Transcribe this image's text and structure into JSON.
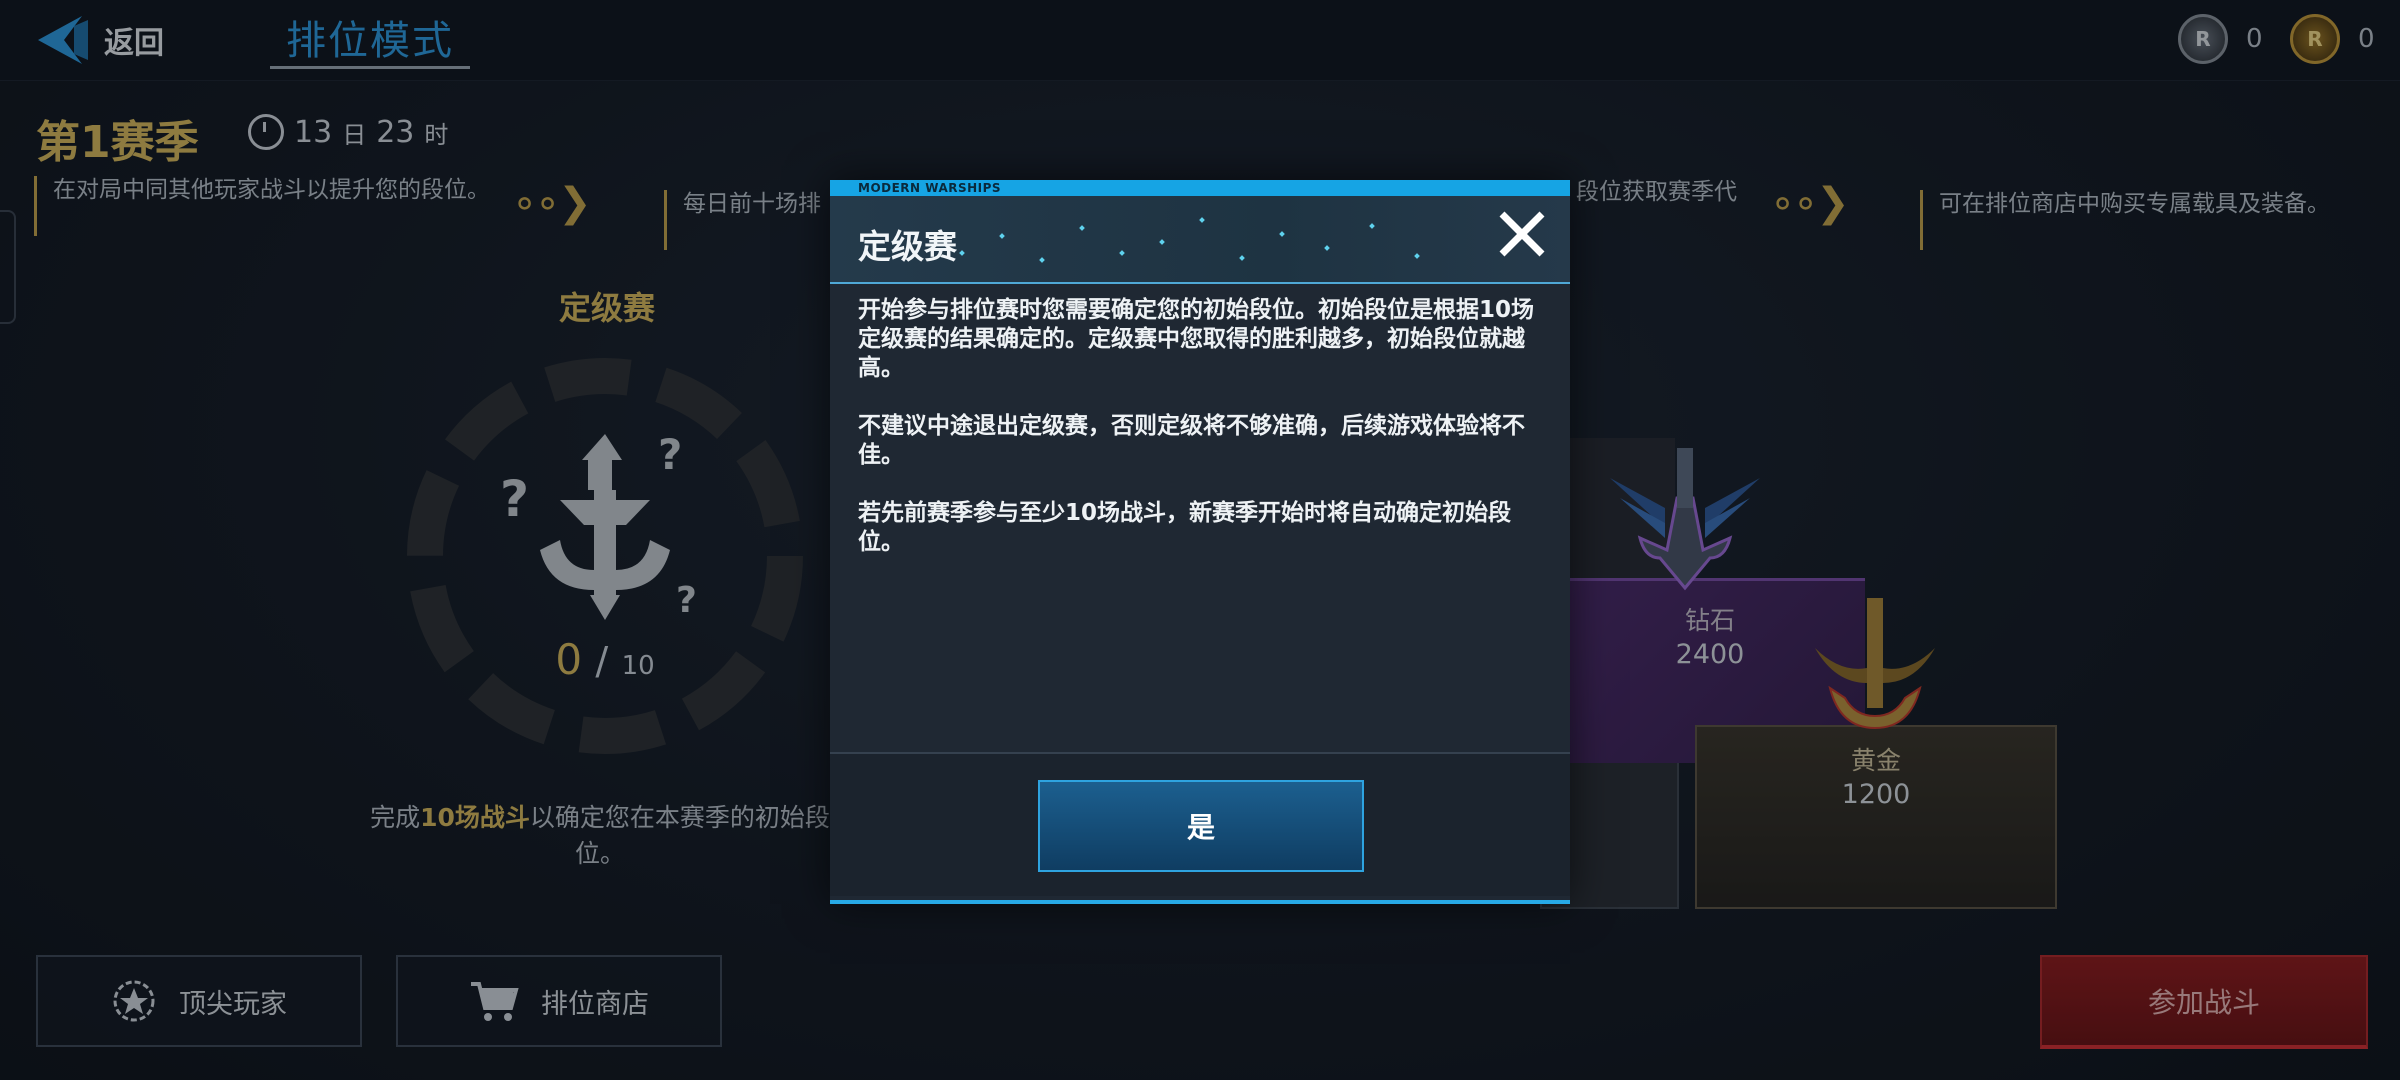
{
  "header": {
    "back_label": "返回",
    "mode_title": "排位模式",
    "mode_subtitle": "",
    "currencies": [
      {
        "icon": "silver-rank-coin-icon",
        "value": "0"
      },
      {
        "icon": "gold-rank-coin-icon",
        "value": "0"
      }
    ]
  },
  "season": {
    "title": "第1赛季",
    "timer_days": "13",
    "timer_days_unit": "日",
    "timer_hours": "23",
    "timer_hours_unit": "时"
  },
  "info_strip": [
    "在对局中同其他玩家战斗以提升您的段位。",
    "每日前十场排",
    "段位获取赛季代",
    "可在排位商店中购买专属载具及装备。"
  ],
  "qualifier": {
    "title": "定级赛",
    "done": "0",
    "separator": "/",
    "total": "10",
    "hint_pre": "完成",
    "hint_highlight": "10场战斗",
    "hint_post": "以确定您在本赛季的初始段位。"
  },
  "ranks": [
    {
      "name": "钻石",
      "points": "2400"
    },
    {
      "name": "黄金",
      "points": "1200"
    }
  ],
  "buttons": {
    "top_players": "顶尖玩家",
    "rank_shop": "排位商店",
    "join_battle": "参加战斗"
  },
  "modal": {
    "brand": "MODERN WARSHIPS",
    "title": "定级赛",
    "paragraphs": [
      "开始参与排位赛时您需要确定您的初始段位。初始段位是根据10场定级赛的结果确定的。定级赛中您取得的胜利越多，初始段位就越高。",
      "不建议中途退出定级赛，否则定级将不够准确，后续游戏体验将不佳。",
      "若先前赛季参与至少10场战斗，新赛季开始时将自动确定初始段位。"
    ],
    "confirm_label": "是"
  },
  "colors": {
    "accent_gold": "#d7b95c",
    "accent_blue": "#27a9e6",
    "join_red": "#8e1b1e",
    "diamond_purple": "#4b2a6b"
  }
}
